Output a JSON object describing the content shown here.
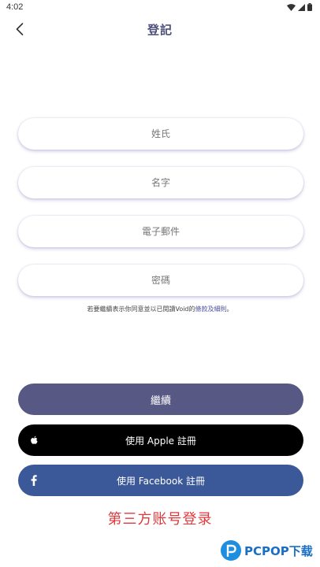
{
  "status_bar": {
    "time": "4:02"
  },
  "header": {
    "title": "登記"
  },
  "form": {
    "last_name_placeholder": "姓氏",
    "first_name_placeholder": "名字",
    "email_placeholder": "電子郵件",
    "password_placeholder": "密碼"
  },
  "terms": {
    "prefix": "若要繼續表示你同意並以已閱讀Void的",
    "link": "條款及細則",
    "suffix": "。"
  },
  "actions": {
    "continue_label": "繼續",
    "apple_label": "使用 Apple 註冊",
    "facebook_label": "使用 Facebook 註冊"
  },
  "overlay": {
    "caption": "第三方账号登录",
    "logo_text": "PCPOP下载"
  },
  "colors": {
    "accent": "#575884",
    "title": "#4d4f7c",
    "apple": "#000000",
    "facebook": "#3b5998",
    "caption": "#e0393d"
  }
}
